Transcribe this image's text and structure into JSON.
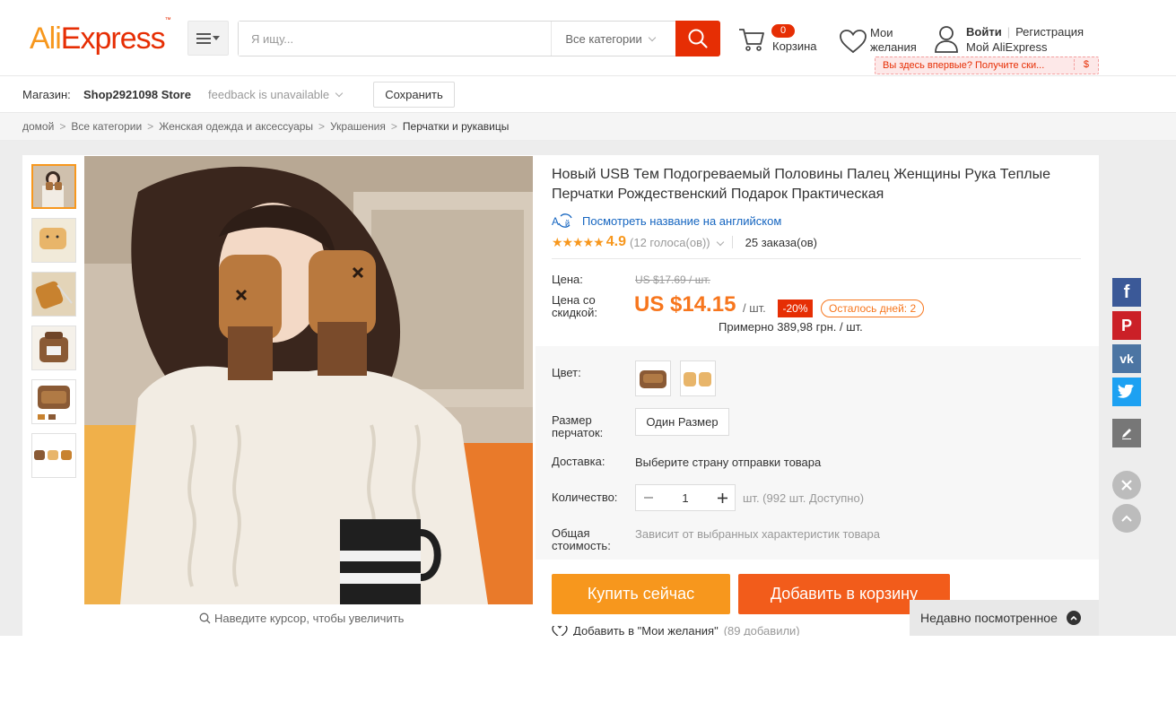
{
  "header": {
    "logo_ali": "Ali",
    "logo_express": "Express",
    "logo_tm": "™",
    "search_placeholder": "Я ищу...",
    "search_category": "Все категории",
    "cart_count": "0",
    "cart_label": "Корзина",
    "wishlist_line1": "Мои",
    "wishlist_line2": "желания",
    "login": "Войти",
    "register": "Регистрация",
    "my_aliexpress": "Мой AliExpress",
    "promo_text": "Вы здесь впервые? Получите ски...",
    "promo_dollar": "$"
  },
  "store": {
    "label": "Магазин:",
    "name": "Shop2921098 Store",
    "feedback": "feedback is unavailable",
    "save_label": "Сохранить"
  },
  "breadcrumb": {
    "home": "домой",
    "items": [
      "Все категории",
      "Женская одежда и аксессуары",
      "Украшения"
    ],
    "current": "Перчатки и рукавицы",
    "separator": ">"
  },
  "gallery": {
    "zoom_hint": "Наведите курсор, чтобы увеличить"
  },
  "product": {
    "title": "Новый USB Тем Подогреваемый Половины Палец Женщины Рука Теплые Перчатки Рождественский Подарок Практическая",
    "translate_link": "Посмотреть название на английском",
    "stars": "★★★★★",
    "rating": "4.9",
    "votes": "(12 голоса(ов))",
    "orders": "25 заказа(ов)",
    "price_label": "Цена:",
    "old_price": "US $17.69 / шт.",
    "discount_label": "Цена со скидкой:",
    "new_price": "US $14.15",
    "per_unit": "/ шт.",
    "discount": "-20%",
    "days_left": "Осталось дней: 2",
    "approx_price": "Примерно 389,98 грн. / шт.",
    "color_label": "Цвет:",
    "size_label": "Размер перчаток:",
    "size_value": "Один Размер",
    "shipping_label": "Доставка:",
    "shipping_value": "Выберите страну отправки товара",
    "quantity_label": "Количество:",
    "quantity_value": "1",
    "quantity_available": "шт. (992 шт. Доступно)",
    "total_label": "Общая стоимость:",
    "total_value": "Зависит от выбранных характеристик товара",
    "buy_now": "Купить сейчас",
    "add_to_cart": "Добавить в корзину",
    "add_wishlist": "Добавить в \"Мои желания\"",
    "wishlist_count": "(89 добавили)"
  },
  "recently_viewed": {
    "label": "Недавно посмотренное"
  },
  "colors": {
    "accent": "#e62e04",
    "orange": "#f7971d",
    "price": "#f7761d",
    "facebook": "#3b5998",
    "pinterest": "#cb2027",
    "vk": "#4c75a3",
    "twitter": "#1da1f2"
  },
  "social": {
    "facebook_glyph": "f",
    "pinterest_glyph": "P",
    "vk_glyph": "vk"
  }
}
